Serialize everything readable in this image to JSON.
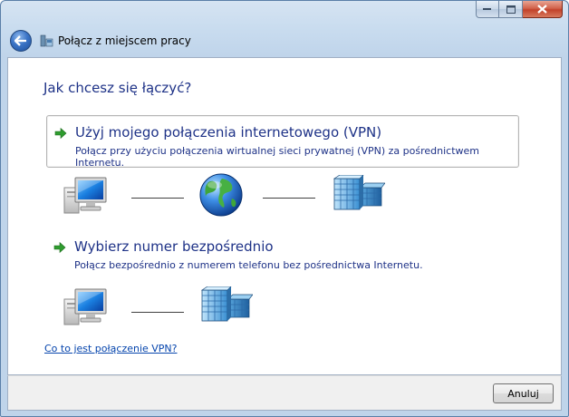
{
  "window": {
    "title": "Połącz z miejscem pracy"
  },
  "main": {
    "question": "Jak chcesz się łączyć?",
    "options": [
      {
        "title": "Użyj mojego połączenia internetowego (VPN)",
        "description": "Połącz przy użyciu połączenia wirtualnej sieci prywatnej (VPN) za pośrednictwem Internetu."
      },
      {
        "title": "Wybierz numer bezpośrednio",
        "description": "Połącz bezpośrednio z numerem telefonu bez pośrednictwa Internetu."
      }
    ],
    "help_link": "Co to jest połączenie VPN?"
  },
  "footer": {
    "cancel_label": "Anuluj"
  },
  "icons": {
    "back": "back-arrow-icon",
    "nav": "network-connection-icon",
    "computer": "computer-icon",
    "globe": "globe-icon",
    "workplace": "office-building-icon",
    "option_arrow": "green-arrow-icon"
  },
  "colors": {
    "link_text": "#1e3287",
    "hyperlink": "#0645ad",
    "window_frame": "#bfd4ea"
  }
}
